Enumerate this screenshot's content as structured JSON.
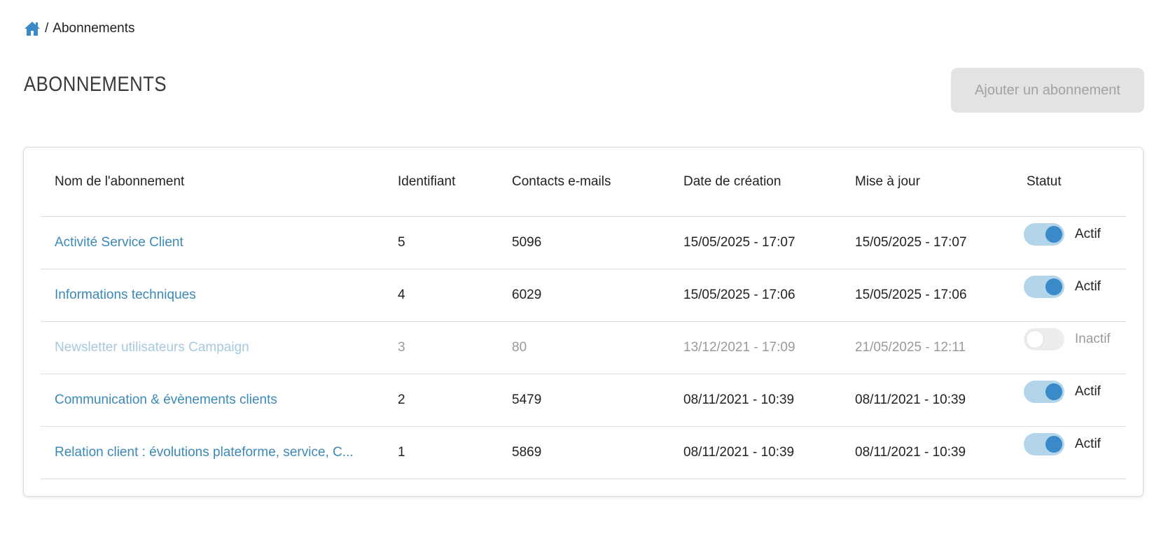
{
  "breadcrumb": {
    "separator": "/",
    "current": "Abonnements"
  },
  "page": {
    "title": "ABONNEMENTS",
    "add_button_label": "Ajouter un abonnement"
  },
  "table": {
    "headers": {
      "name": "Nom de l'abonnement",
      "id": "Identifiant",
      "contacts": "Contacts e-mails",
      "created": "Date de création",
      "updated": "Mise à jour",
      "status": "Statut"
    },
    "rows": [
      {
        "name": "Activité Service Client",
        "id": "5",
        "contacts": "5096",
        "created": "15/05/2025 - 17:07",
        "updated": "15/05/2025 - 17:07",
        "status": "Actif",
        "active": true
      },
      {
        "name": "Informations techniques",
        "id": "4",
        "contacts": "6029",
        "created": "15/05/2025 - 17:06",
        "updated": "15/05/2025 - 17:06",
        "status": "Actif",
        "active": true
      },
      {
        "name": "Newsletter utilisateurs Campaign",
        "id": "3",
        "contacts": "80",
        "created": "13/12/2021 - 17:09",
        "updated": "21/05/2025 - 12:11",
        "status": "Inactif",
        "active": false
      },
      {
        "name": "Communication & évènements clients",
        "id": "2",
        "contacts": "5479",
        "created": "08/11/2021 - 10:39",
        "updated": "08/11/2021 - 10:39",
        "status": "Actif",
        "active": true
      },
      {
        "name": "Relation client : évolutions plateforme, service, C...",
        "id": "1",
        "contacts": "5869",
        "created": "08/11/2021 - 10:39",
        "updated": "08/11/2021 - 10:39",
        "status": "Actif",
        "active": true
      }
    ]
  },
  "colors": {
    "link": "#3a89b6",
    "toggle_on_track": "#b3d5ea",
    "toggle_on_knob": "#3a89c8",
    "toggle_off_track": "#ededed",
    "button_disabled_bg": "#e3e3e3",
    "button_disabled_text": "#a2a2a2"
  },
  "icons": {
    "home": "home-icon"
  }
}
